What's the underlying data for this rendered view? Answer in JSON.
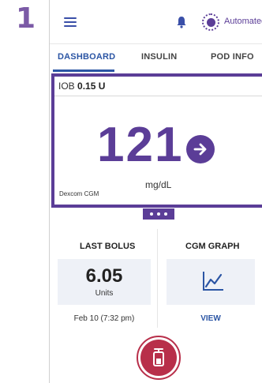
{
  "step": {
    "number": "1"
  },
  "header": {
    "menu_icon": "hamburger-icon",
    "notification_icon": "bell-icon",
    "mode_icon": "automated-mode-icon",
    "mode_label": "Automated"
  },
  "tabs": [
    {
      "label": "DASHBOARD",
      "active": true
    },
    {
      "label": "INSULIN",
      "active": false
    },
    {
      "label": "POD INFO",
      "active": false
    }
  ],
  "cgm_card": {
    "iob_label": "IOB",
    "iob_value": "0.15 U",
    "glucose_value": "121",
    "glucose_unit": "mg/dL",
    "trend_icon": "arrow-right-icon",
    "source": "Dexcom CGM"
  },
  "pager": {
    "pages": 3
  },
  "last_bolus": {
    "title": "LAST BOLUS",
    "value": "6.05",
    "unit": "Units",
    "time": "Feb 10 (7:32 pm)"
  },
  "cgm_graph": {
    "title": "CGM GRAPH",
    "icon": "line-chart-icon",
    "link_label": "VIEW"
  },
  "bolus_button": {
    "icon": "bolus-icon"
  },
  "colors": {
    "accent_purple": "#5b3d97",
    "link_blue": "#2b55a4",
    "bolus_red": "#b82f4a",
    "step_purple": "#7b5aa6"
  }
}
